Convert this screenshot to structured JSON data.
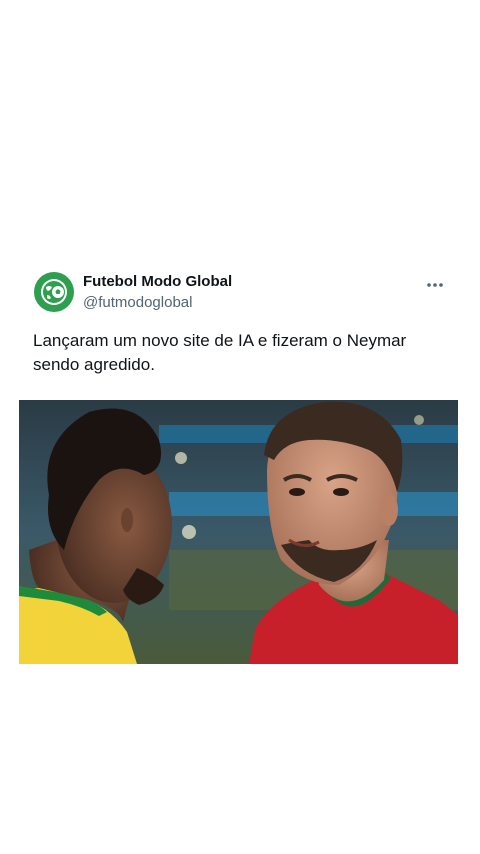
{
  "post": {
    "author": {
      "display_name": "Futebol Modo Global",
      "handle": "@futmodoglobal",
      "avatar_icon": "soccer-ball-globe-icon",
      "avatar_color": "#2e9e4f"
    },
    "more_icon": "more-options-icon",
    "text": "Lançaram um novo site de IA e fizeram o Neymar sendo agredido.",
    "media": {
      "type": "photo"
    }
  },
  "colors": {
    "text_primary": "#0f1419",
    "text_secondary": "#536471",
    "brazil_yellow": "#f2d43a",
    "portugal_red": "#c8202a"
  }
}
